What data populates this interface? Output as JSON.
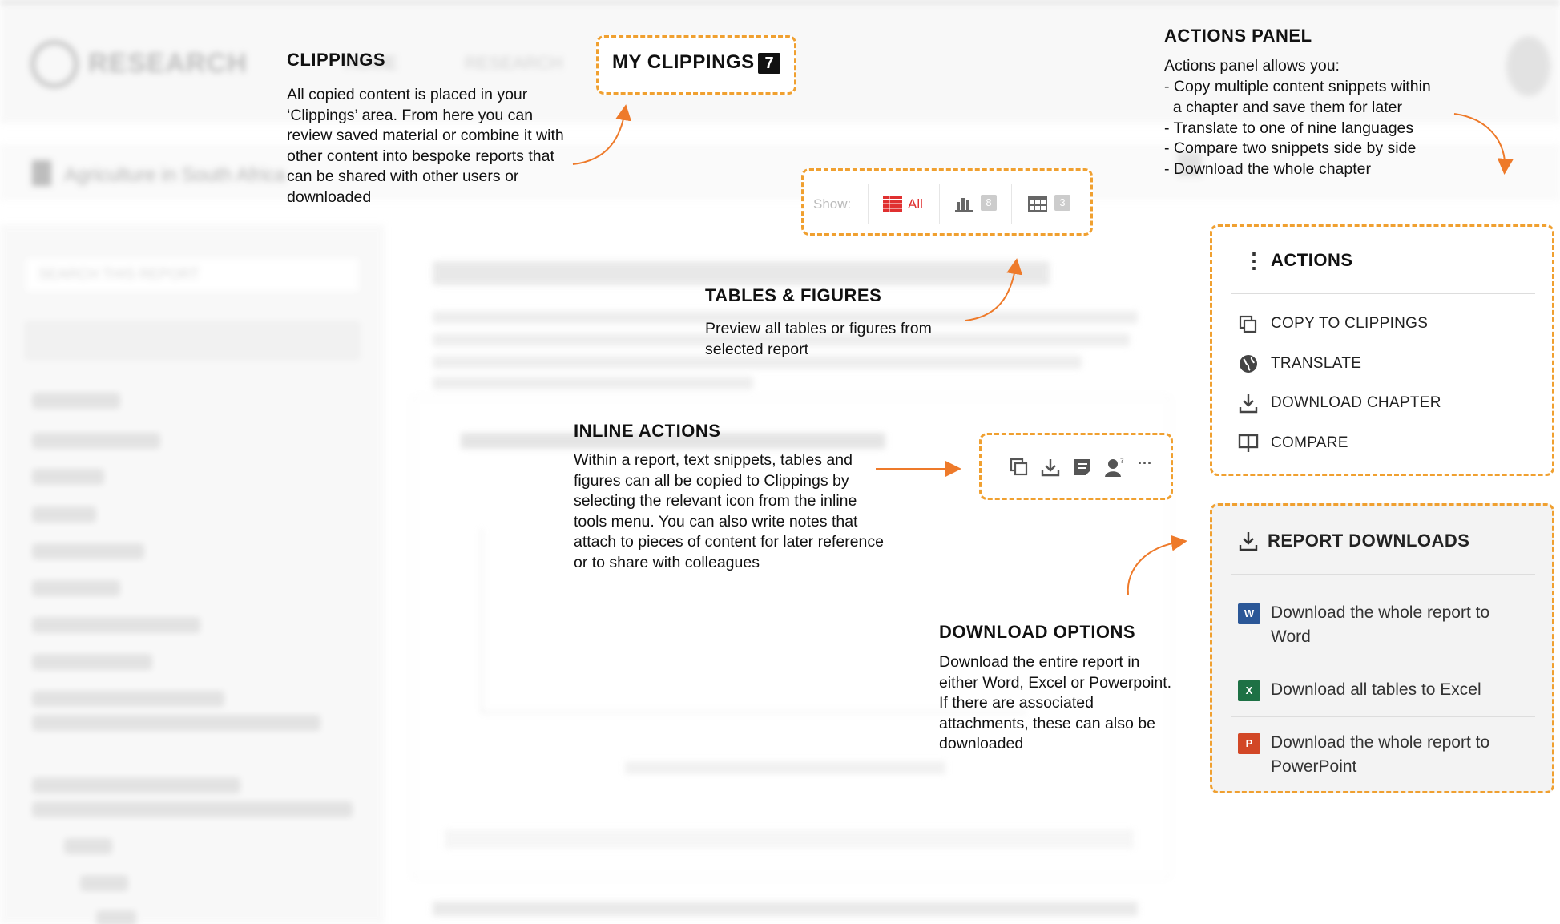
{
  "background": {
    "logo_text": "RESEARCH",
    "nav_home": "HOME",
    "nav_research": "RESEARCH",
    "breadcrumb_title": "Agriculture in South Africa",
    "search_placeholder": "SEARCH THIS REPORT"
  },
  "clippings": {
    "title": "CLIPPINGS",
    "body": "All copied content is placed in your ‘Clippings’ area. From here you can review saved material or combine it with other content into bespoke reports that can be shared with other users or downloaded",
    "button_label": "MY CLIPPINGS",
    "button_count": "7"
  },
  "show_filter": {
    "label": "Show:",
    "all_label": "All",
    "figures_count": "8",
    "tables_count": "3"
  },
  "tables_figures": {
    "title": "TABLES & FIGURES",
    "body": "Preview all tables or figures from selected report"
  },
  "inline_actions": {
    "title": "INLINE ACTIONS",
    "body": "Within a report, text snippets, tables and figures can all be copied to Clippings by selecting the relevant icon from the inline tools menu. You can also write notes that attach to pieces of content for later reference or to share with colleagues",
    "more_label": "···"
  },
  "actions_panel_callout": {
    "title": "ACTIONS PANEL",
    "intro": "Actions panel allows you:",
    "bullets": [
      "- Copy multiple content snippets within",
      "  a chapter and save them for later",
      "- Translate to one of nine languages",
      "- Compare two snippets side by side",
      "- Download the whole chapter"
    ]
  },
  "actions": {
    "title": "ACTIONS",
    "items": [
      {
        "label": "COPY TO CLIPPINGS",
        "icon": "copy-icon"
      },
      {
        "label": "TRANSLATE",
        "icon": "globe-icon"
      },
      {
        "label": "DOWNLOAD CHAPTER",
        "icon": "download-icon"
      },
      {
        "label": "COMPARE",
        "icon": "compare-icon"
      }
    ]
  },
  "download_options": {
    "title": "DOWNLOAD OPTIONS",
    "body": "Download the entire report in either Word, Excel or Powerpoint. If there are associated attachments, these can also be downloaded"
  },
  "report_downloads": {
    "title": "REPORT DOWNLOADS",
    "items": [
      {
        "label": "Download the whole report to Word",
        "icon": "word-file-icon",
        "badge": "W",
        "color": "#2b5797"
      },
      {
        "label": "Download all tables to Excel",
        "icon": "excel-file-icon",
        "badge": "X",
        "color": "#1e7145"
      },
      {
        "label": "Download the whole report to PowerPoint",
        "icon": "powerpoint-file-icon",
        "badge": "P",
        "color": "#d24726"
      }
    ]
  },
  "colors": {
    "callout_dash": "#f0a030",
    "arrow": "#ee7a2a",
    "accent_red": "#e03030"
  }
}
